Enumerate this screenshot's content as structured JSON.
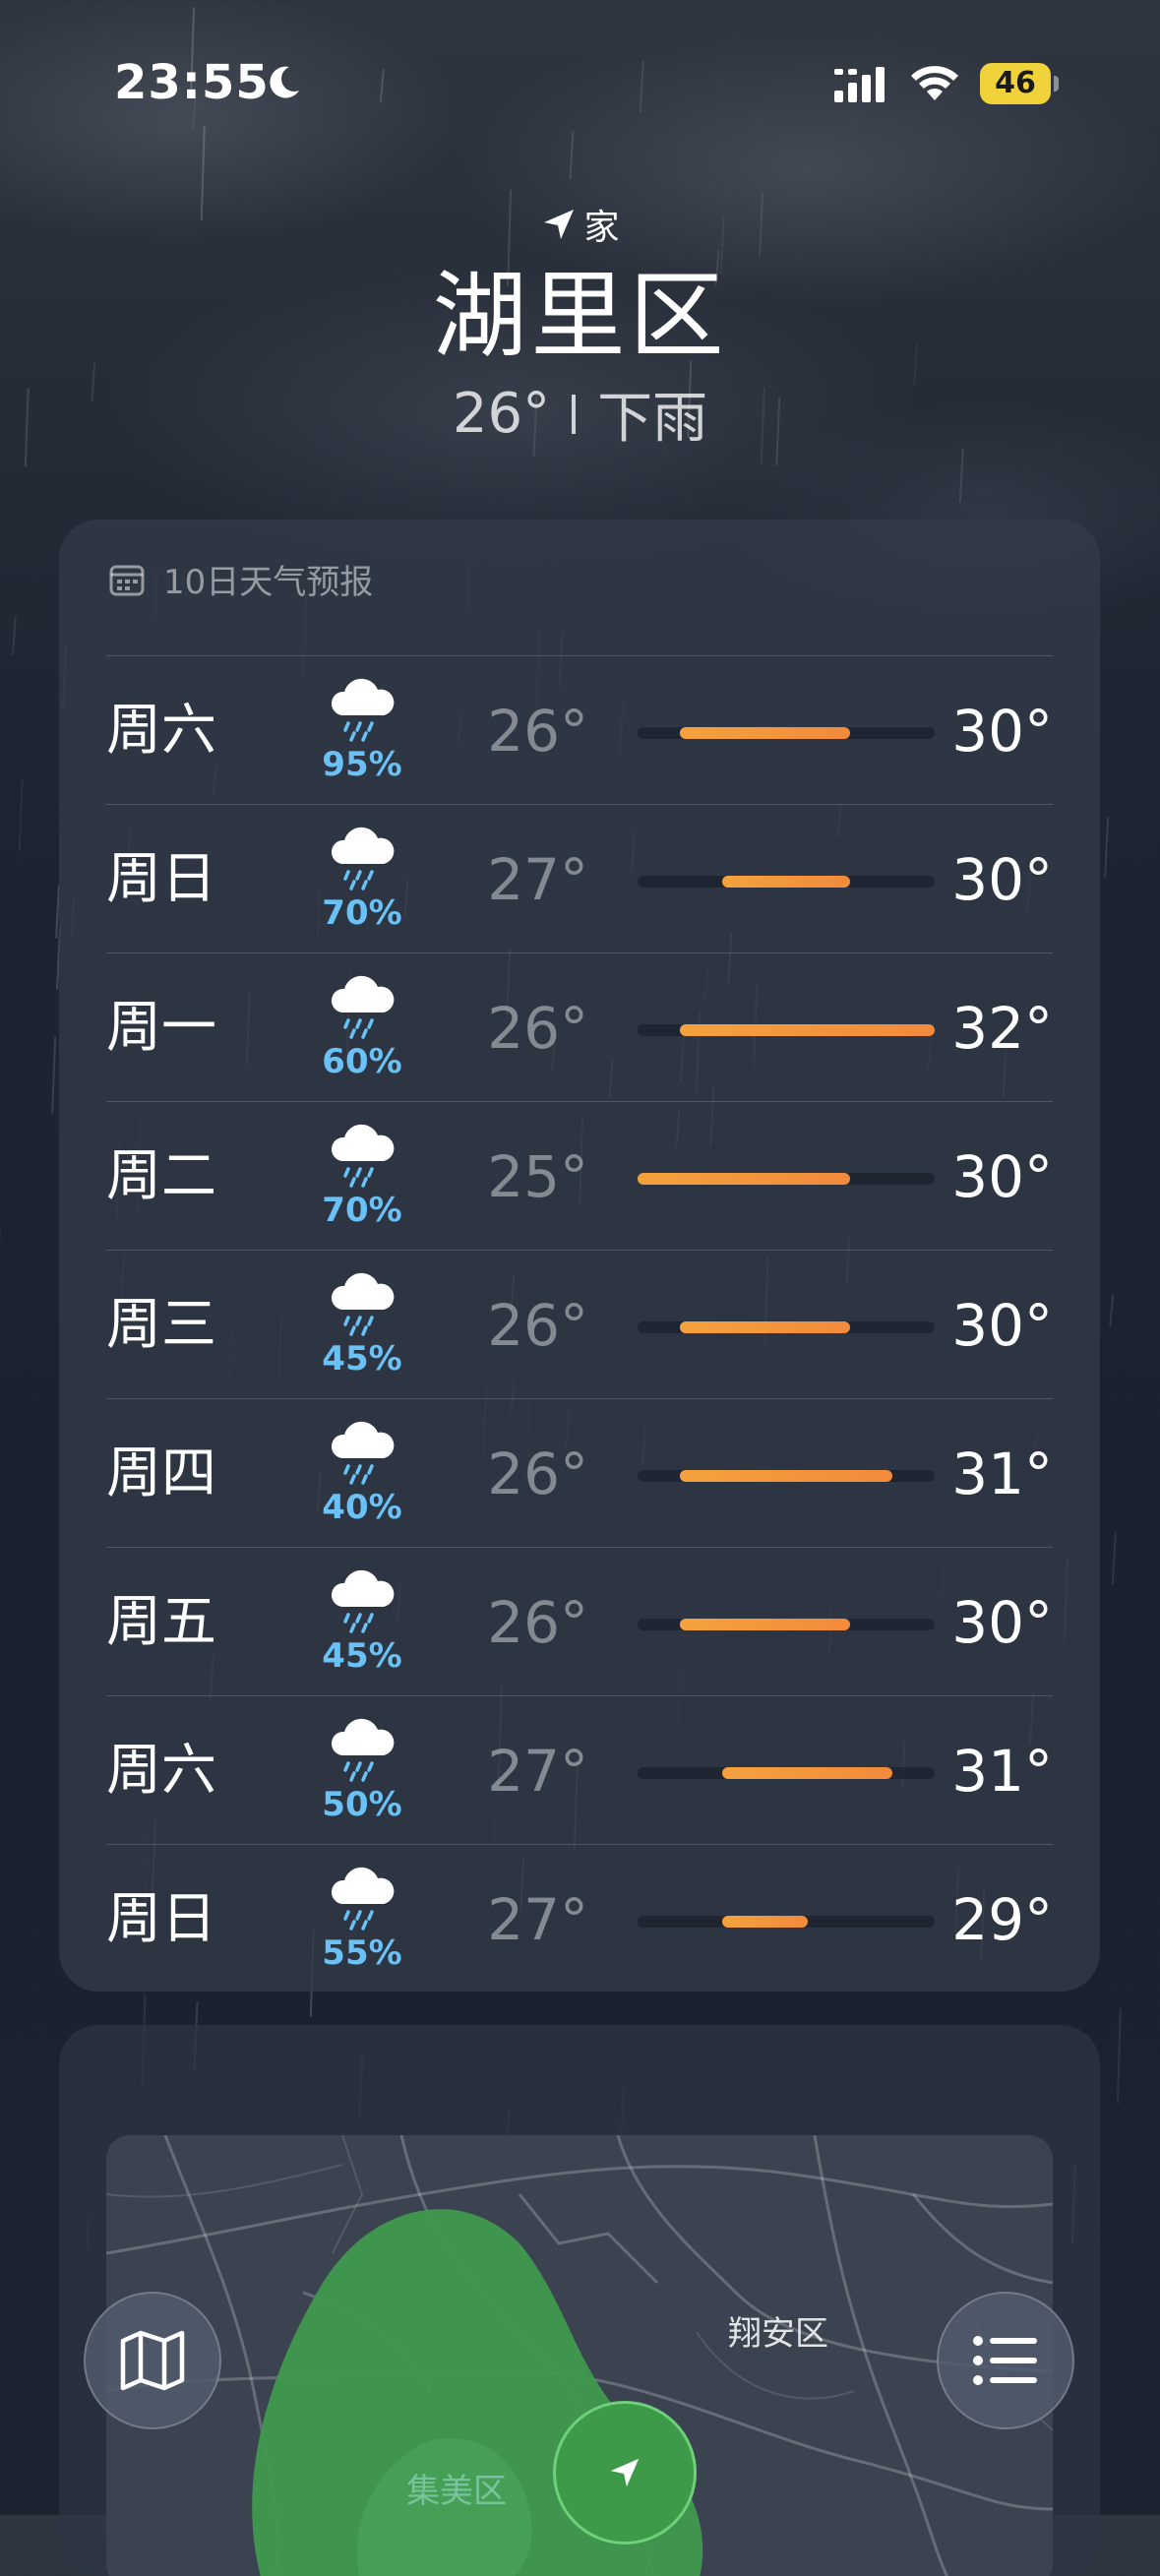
{
  "status_bar": {
    "time": "23:55",
    "battery": "46",
    "icons": [
      "moon-icon",
      "cellular-signal-icon",
      "wifi-icon",
      "battery-icon"
    ]
  },
  "header": {
    "location_tag": "家",
    "city": "湖里区",
    "current_temp": "26°",
    "condition": "下雨"
  },
  "forecast": {
    "title": "10日天气预报",
    "range_min": 25,
    "range_max": 32,
    "days": [
      {
        "day": "周六",
        "precip": "95%",
        "low": "26°",
        "high": "30°",
        "low_val": 26,
        "high_val": 30,
        "icon": "rain-cloud-icon"
      },
      {
        "day": "周日",
        "precip": "70%",
        "low": "27°",
        "high": "30°",
        "low_val": 27,
        "high_val": 30,
        "icon": "rain-cloud-icon"
      },
      {
        "day": "周一",
        "precip": "60%",
        "low": "26°",
        "high": "32°",
        "low_val": 26,
        "high_val": 32,
        "icon": "rain-cloud-icon"
      },
      {
        "day": "周二",
        "precip": "70%",
        "low": "25°",
        "high": "30°",
        "low_val": 25,
        "high_val": 30,
        "icon": "rain-cloud-icon"
      },
      {
        "day": "周三",
        "precip": "45%",
        "low": "26°",
        "high": "30°",
        "low_val": 26,
        "high_val": 30,
        "icon": "rain-cloud-icon"
      },
      {
        "day": "周四",
        "precip": "40%",
        "low": "26°",
        "high": "31°",
        "low_val": 26,
        "high_val": 31,
        "icon": "rain-cloud-icon"
      },
      {
        "day": "周五",
        "precip": "45%",
        "low": "26°",
        "high": "30°",
        "low_val": 26,
        "high_val": 30,
        "icon": "rain-cloud-icon"
      },
      {
        "day": "周六",
        "precip": "50%",
        "low": "27°",
        "high": "31°",
        "low_val": 27,
        "high_val": 31,
        "icon": "rain-cloud-icon"
      },
      {
        "day": "周日",
        "precip": "55%",
        "low": "27°",
        "high": "29°",
        "low_val": 27,
        "high_val": 29,
        "icon": "rain-cloud-icon"
      }
    ]
  },
  "map": {
    "labels": [
      "翔安区",
      "集美区"
    ]
  },
  "toolbar": {
    "map_button_icon": "map-icon",
    "list_button_icon": "list-icon"
  },
  "colors": {
    "temp_bar": "#f4a23d",
    "precip_text": "#69c1f5",
    "radar_green": "#3c9a48"
  }
}
